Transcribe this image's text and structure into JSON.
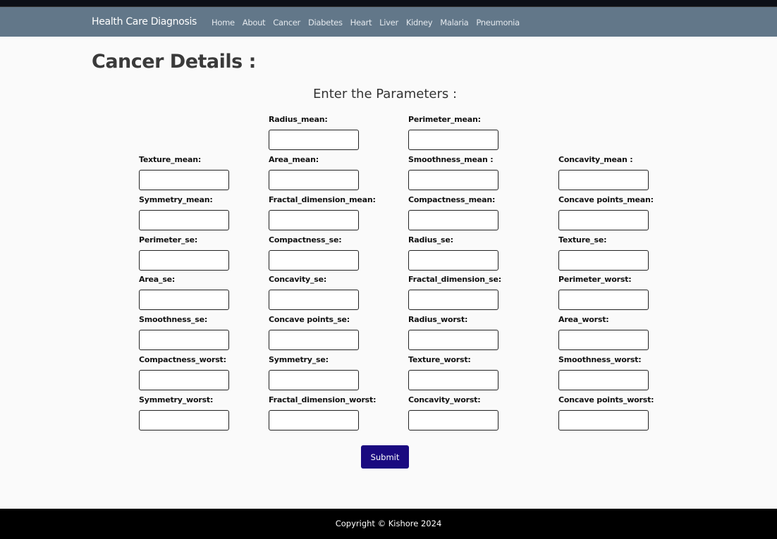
{
  "nav": {
    "brand": "Health Care Diagnosis",
    "links": [
      "Home",
      "About",
      "Cancer",
      "Diabetes",
      "Heart",
      "Liver",
      "Kidney",
      "Malaria",
      "Pneumonia"
    ]
  },
  "page_title": "Cancer Details :",
  "form": {
    "heading": "Enter the Parameters :",
    "submit_label": "Submit",
    "rows": [
      [
        null,
        "Radius_mean:",
        "Perimeter_mean:",
        null
      ],
      [
        "Texture_mean:",
        "Area_mean:",
        "Smoothness_mean :",
        "Concavity_mean :"
      ],
      [
        "Symmetry_mean:",
        "Fractal_dimension_mean:",
        "Compactness_mean:",
        "Concave points_mean:"
      ],
      [
        "Perimeter_se:",
        "Compactness_se:",
        "Radius_se:",
        "Texture_se:"
      ],
      [
        "Area_se:",
        "Concavity_se:",
        "Fractal_dimension_se:",
        "Perimeter_worst:"
      ],
      [
        "Smoothness_se:",
        "Concave points_se:",
        "Radius_worst:",
        "Area_worst:"
      ],
      [
        "Compactness_worst:",
        "Symmetry_se:",
        "Texture_worst:",
        "Smoothness_worst:"
      ],
      [
        "Symmetry_worst:",
        "Fractal_dimension_worst:",
        "Concavity_worst:",
        "Concave points_worst:"
      ]
    ]
  },
  "footer": "Copyright © Kishore 2024"
}
